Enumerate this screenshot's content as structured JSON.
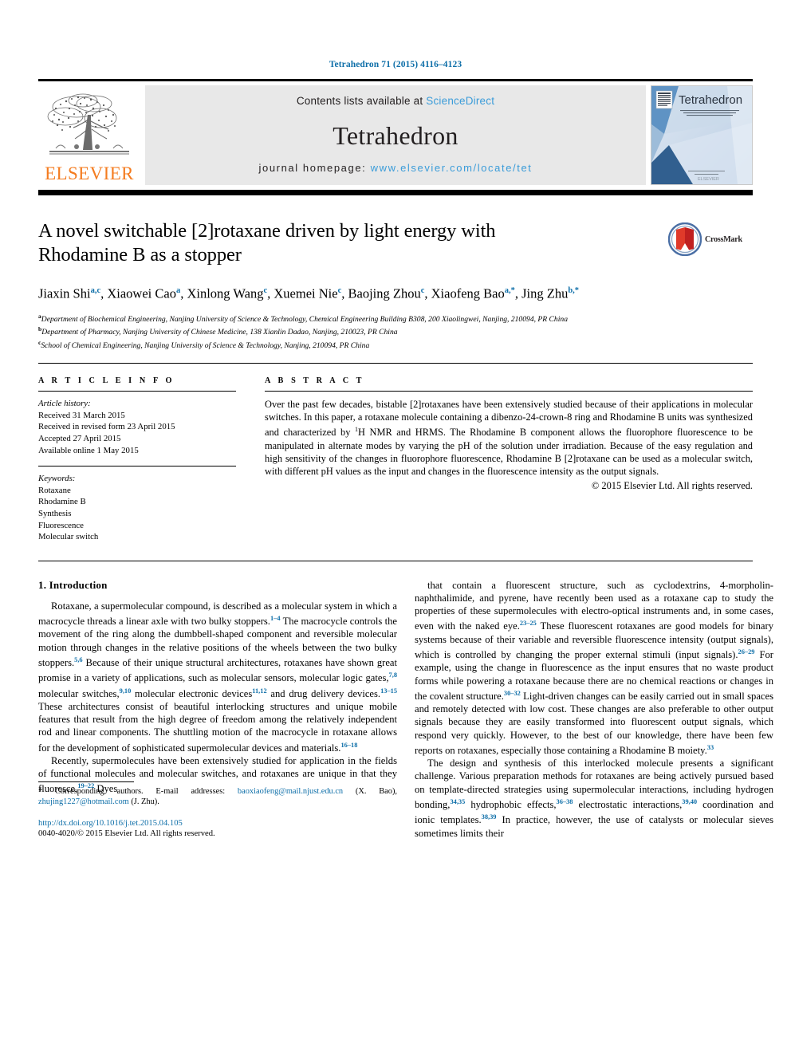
{
  "header": {
    "journal_ref": "Tetrahedron 71 (2015) 4116–4123"
  },
  "masthead": {
    "publisher_name": "ELSEVIER",
    "contents_prefix": "Contents lists available at ",
    "contents_link": "ScienceDirect",
    "journal_name": "Tetrahedron",
    "homepage_prefix": "journal homepage: ",
    "homepage_url": "www.elsevier.com/locate/tet",
    "cover_title": "Tetrahedron",
    "cover_subtitle": "An International Journal for the Rapid Publication of Full Original Research Papers and Critical Reviews in Organic Chemistry",
    "cover_footer": "ELSEVIER"
  },
  "title_block": {
    "title_line1": "A novel switchable [2]rotaxane driven by light energy with",
    "title_line2": "Rhodamine B as a stopper",
    "crossmark_label": "CrossMark",
    "authors_html": "Jiaxin Shi<sup>a,c</sup>, Xiaowei Cao<sup>a</sup>, Xinlong Wang<sup>c</sup>, Xuemei Nie<sup>c</sup>, Baojing Zhou<sup>c</sup>, Xiaofeng Bao<sup>a,*</sup>, Jing Zhu<sup>b,*</sup>",
    "affiliations": [
      {
        "label": "a",
        "text": "Department of Biochemical Engineering, Nanjing University of Science & Technology, Chemical Engineering Building B308, 200 Xiaolingwei, Nanjing, 210094, PR China"
      },
      {
        "label": "b",
        "text": "Department of Pharmacy, Nanjing University of Chinese Medicine, 138 Xianlin Dadao, Nanjing, 210023, PR China"
      },
      {
        "label": "c",
        "text": "School of Chemical Engineering, Nanjing University of Science & Technology, Nanjing, 210094, PR China"
      }
    ]
  },
  "article_info": {
    "heading": "A R T I C L E   I N F O",
    "history_title": "Article history:",
    "history": [
      "Received 31 March 2015",
      "Received in revised form 23 April 2015",
      "Accepted 27 April 2015",
      "Available online 1 May 2015"
    ],
    "keywords_title": "Keywords:",
    "keywords": [
      "Rotaxane",
      "Rhodamine B",
      "Synthesis",
      "Fluorescence",
      "Molecular switch"
    ]
  },
  "abstract": {
    "heading": "A B S T R A C T",
    "text_html": "Over the past few decades, bistable [2]rotaxanes have been extensively studied because of their applications in molecular switches. In this paper, a rotaxane molecule containing a dibenzo-24-crown-8 ring and Rhodamine B units was synthesized and characterized by <sup>1</sup>H NMR and HRMS. The Rhodamine B component allows the fluorophore fluorescence to be manipulated in alternate modes by varying the pH of the solution under irradiation. Because of the easy regulation and high sensitivity of the changes in fluorophore fluorescence, Rhodamine B [2]rotaxane can be used as a molecular switch, with different pH values as the input and changes in the fluorescence intensity as the output signals.",
    "copyright": "© 2015 Elsevier Ltd. All rights reserved."
  },
  "body": {
    "section_heading": "1. Introduction",
    "left_paragraphs_html": [
      "Rotaxane, a supermolecular compound, is described as a molecular system in which a macrocycle threads a linear axle with two bulky stoppers.<sup class=\"ref\">1–4</sup> The macrocycle controls the movement of the ring along the dumbbell-shaped component and reversible molecular motion through changes in the relative positions of the wheels between the two bulky stoppers.<sup class=\"ref\">5,6</sup> Because of their unique structural architectures, rotaxanes have shown great promise in a variety of applications, such as molecular sensors, molecular logic gates,<sup class=\"ref\">7,8</sup> molecular switches,<sup class=\"ref\">9,10</sup> molecular electronic devices<sup class=\"ref\">11,12</sup> and drug delivery devices.<sup class=\"ref\">13–15</sup> These architectures consist of beautiful interlocking structures and unique mobile features that result from the high degree of freedom among the relatively independent rod and linear components. The shuttling motion of the macrocycle in rotaxane allows for the development of sophisticated supermolecular devices and materials.<sup class=\"ref\">16–18</sup>",
      "Recently, supermolecules have been extensively studied for application in the fields of functional molecules and molecular switches, and rotaxanes are unique in that they fluoresce.<sup class=\"ref\">19–22</sup> Dyes"
    ],
    "right_paragraphs_html": [
      "that contain a fluorescent structure, such as cyclodextrins, 4-morpholin-naphthalimide, and pyrene, have recently been used as a rotaxane cap to study the properties of these supermolecules with electro-optical instruments and, in some cases, even with the naked eye.<sup class=\"ref\">23–25</sup> These fluorescent rotaxanes are good models for binary systems because of their variable and reversible fluorescence intensity (output signals), which is controlled by changing the proper external stimuli (input signals).<sup class=\"ref\">26–29</sup> For example, using the change in fluorescence as the input ensures that no waste product forms while powering a rotaxane because there are no chemical reactions or changes in the covalent structure.<sup class=\"ref\">30–32</sup> Light-driven changes can be easily carried out in small spaces and remotely detected with low cost. These changes are also preferable to other output signals because they are easily transformed into fluorescent output signals, which respond very quickly. However, to the best of our knowledge, there have been few reports on rotaxanes, especially those containing a Rhodamine B moiety.<sup class=\"ref\">33</sup>",
      "The design and synthesis of this interlocked molecule presents a significant challenge. Various preparation methods for rotaxanes are being actively pursued based on template-directed strategies using supermolecular interactions, including hydrogen bonding,<sup class=\"ref\">34,35</sup> hydrophobic effects,<sup class=\"ref\">36–38</sup> electrostatic interactions,<sup class=\"ref\">39,40</sup> coordination and ionic templates.<sup class=\"ref\">38,39</sup> In practice, however, the use of catalysts or molecular sieves sometimes limits their"
    ]
  },
  "footer": {
    "footnote_html": "* Corresponding authors. E-mail addresses: <a class=\"mail\" data-name=\"email-link-bao\">baoxiaofeng@mail.njust.edu.cn</a> (X. Bao), <a class=\"mail\" data-name=\"email-link-zhu\">zhujing1227@hotmail.com</a> (J. Zhu).",
    "doi": "http://dx.doi.org/10.1016/j.tet.2015.04.105",
    "issn_line": "0040-4020/© 2015 Elsevier Ltd. All rights reserved."
  },
  "colors": {
    "link_blue": "#0d6ea8",
    "sciencedirect_blue": "#3b9cd9",
    "elsevier_orange": "#f47c20",
    "masthead_gray": "#e8e8e8"
  }
}
